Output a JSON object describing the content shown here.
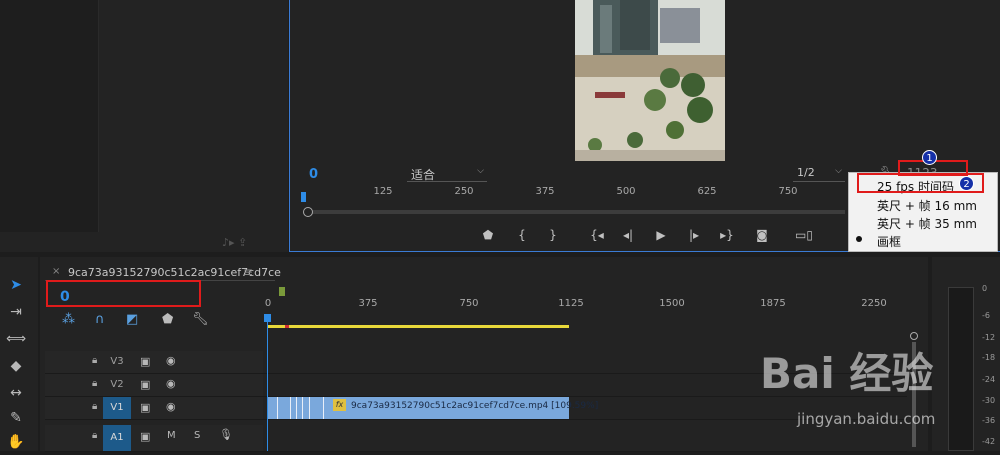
{
  "monitor": {
    "timecode_in": "0",
    "zoom": "适合",
    "resolution": "1/2",
    "timecode_out": "1123",
    "ruler_ticks": [
      "125",
      "250",
      "375",
      "500",
      "625",
      "750"
    ]
  },
  "menu": {
    "items": [
      "25 fps 时间码",
      "英尺 + 帧 16 mm",
      "英尺 + 帧 35 mm",
      "画框"
    ],
    "selected": "画框"
  },
  "badges": [
    "1",
    "2"
  ],
  "sequence": {
    "name": "9ca73a93152790c51c2ac91cef7cd7ce",
    "timecode": "0",
    "ruler_ticks": [
      "0",
      "375",
      "750",
      "1125",
      "1500",
      "1875",
      "2250"
    ]
  },
  "tracks": [
    {
      "name": "V3",
      "active": false
    },
    {
      "name": "V2",
      "active": false
    },
    {
      "name": "V1",
      "active": true
    },
    {
      "name": "A1",
      "active": true,
      "m": "M",
      "s": "S"
    }
  ],
  "clip": {
    "label": "9ca73a93152790c51c2ac91cef7cd7ce.mp4 [109.59%]",
    "fx": "fx"
  },
  "meter_db": [
    "0",
    "-6",
    "-12",
    "-18",
    "-24",
    "-30",
    "-36",
    "-42"
  ],
  "watermark": {
    "brand": "Bai 经验",
    "url": "jingyan.baidu.com"
  }
}
